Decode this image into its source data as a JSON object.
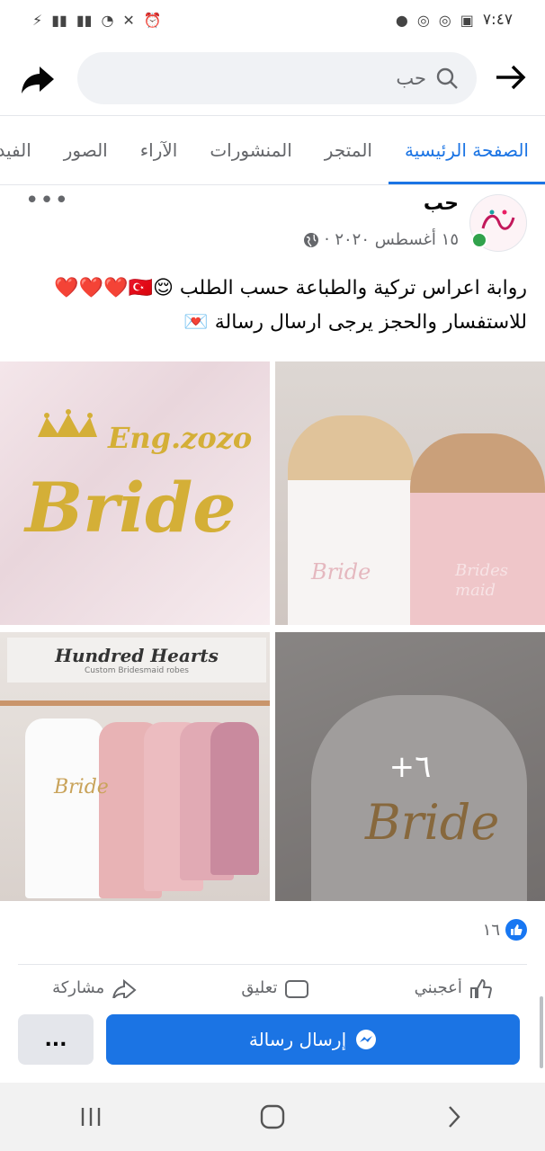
{
  "status_bar": {
    "time": "٧:٤٧"
  },
  "search": {
    "query": "حب"
  },
  "tabs": [
    "الصفحة الرئيسية",
    "المتجر",
    "المنشورات",
    "الآراء",
    "الصور",
    "الفيديوهات"
  ],
  "post": {
    "page_name": "حب",
    "date": "١٥ أغسطس ٢٠٢٠",
    "text_line1": "روابة اعراس تركية والطباعة حسب الطلب 😌🇹🇷❤️❤️❤️",
    "text_line2": "للاستفسار والحجز يرجى ارسال رسالة 💌",
    "photo_texts": {
      "p1_top": "Eng.zozo",
      "p1_main": "Bride",
      "p2_left": "Bride",
      "p2_right": "Brides maid",
      "p3_sign": "Hundred Hearts",
      "p3_sub": "Custom Bridesmaid robes",
      "p3_robe": "Bride",
      "p4_robe": "Bride"
    },
    "more_photos": "٦+",
    "reaction_count": "١٦"
  },
  "actions": {
    "like": "أعجبني",
    "comment": "تعليق",
    "share": "مشاركة"
  },
  "bottom": {
    "send_message": "إرسال رسالة",
    "more": "..."
  },
  "colors": {
    "accent": "#1b74e4",
    "online": "#31a24c"
  }
}
